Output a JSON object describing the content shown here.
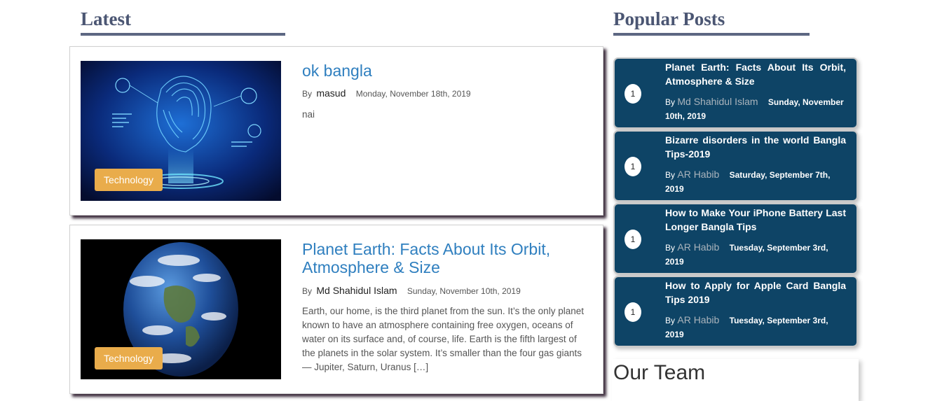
{
  "latest": {
    "heading": "Latest",
    "posts": [
      {
        "category": "Technology",
        "title": "ok bangla",
        "by": "By",
        "author": "masud",
        "date": "Monday, November 18th, 2019",
        "excerpt": "nai",
        "image_icon": "ai-face-hologram-image"
      },
      {
        "category": "Technology",
        "title": "Planet Earth: Facts About Its Orbit, Atmosphere & Size",
        "by": "By",
        "author": "Md Shahidul Islam",
        "date": "Sunday, November 10th, 2019",
        "excerpt": "Earth, our home, is the third planet from the sun. It’s the only planet known to have an atmosphere containing free oxygen, oceans of water on its surface and, of course, life. Earth is the fifth largest of the planets in the solar system. It’s smaller than the four gas giants — Jupiter, Saturn, Uranus […]",
        "image_icon": "earth-globe-image"
      }
    ]
  },
  "popular": {
    "heading": "Popular Posts",
    "items": [
      {
        "num": "1",
        "title": "Planet Earth: Facts About Its Orbit, Atmosphere & Size",
        "by": "By",
        "author": "Md Shahidul Islam",
        "date": "Sunday, November 10th, 2019"
      },
      {
        "num": "1",
        "title": "Bizarre disorders in the world Bangla Tips-2019",
        "by": "By",
        "author": "AR Habib",
        "date": "Saturday, September 7th, 2019"
      },
      {
        "num": "1",
        "title": "How to Make Your iPhone Battery Last Longer Bangla Tips",
        "by": "By",
        "author": "AR Habib",
        "date": "Tuesday, September 3rd, 2019"
      },
      {
        "num": "1",
        "title": "How to Apply for Apple Card Bangla Tips 2019",
        "by": "By",
        "author": "AR Habib",
        "date": "Tuesday, September 3rd, 2019"
      }
    ]
  },
  "team": {
    "heading": "Our Team"
  },
  "colors": {
    "heading": "#4b5673",
    "link": "#2f7fbf",
    "badge": "#e9ac4b",
    "popular_bg": "#0e4466"
  }
}
